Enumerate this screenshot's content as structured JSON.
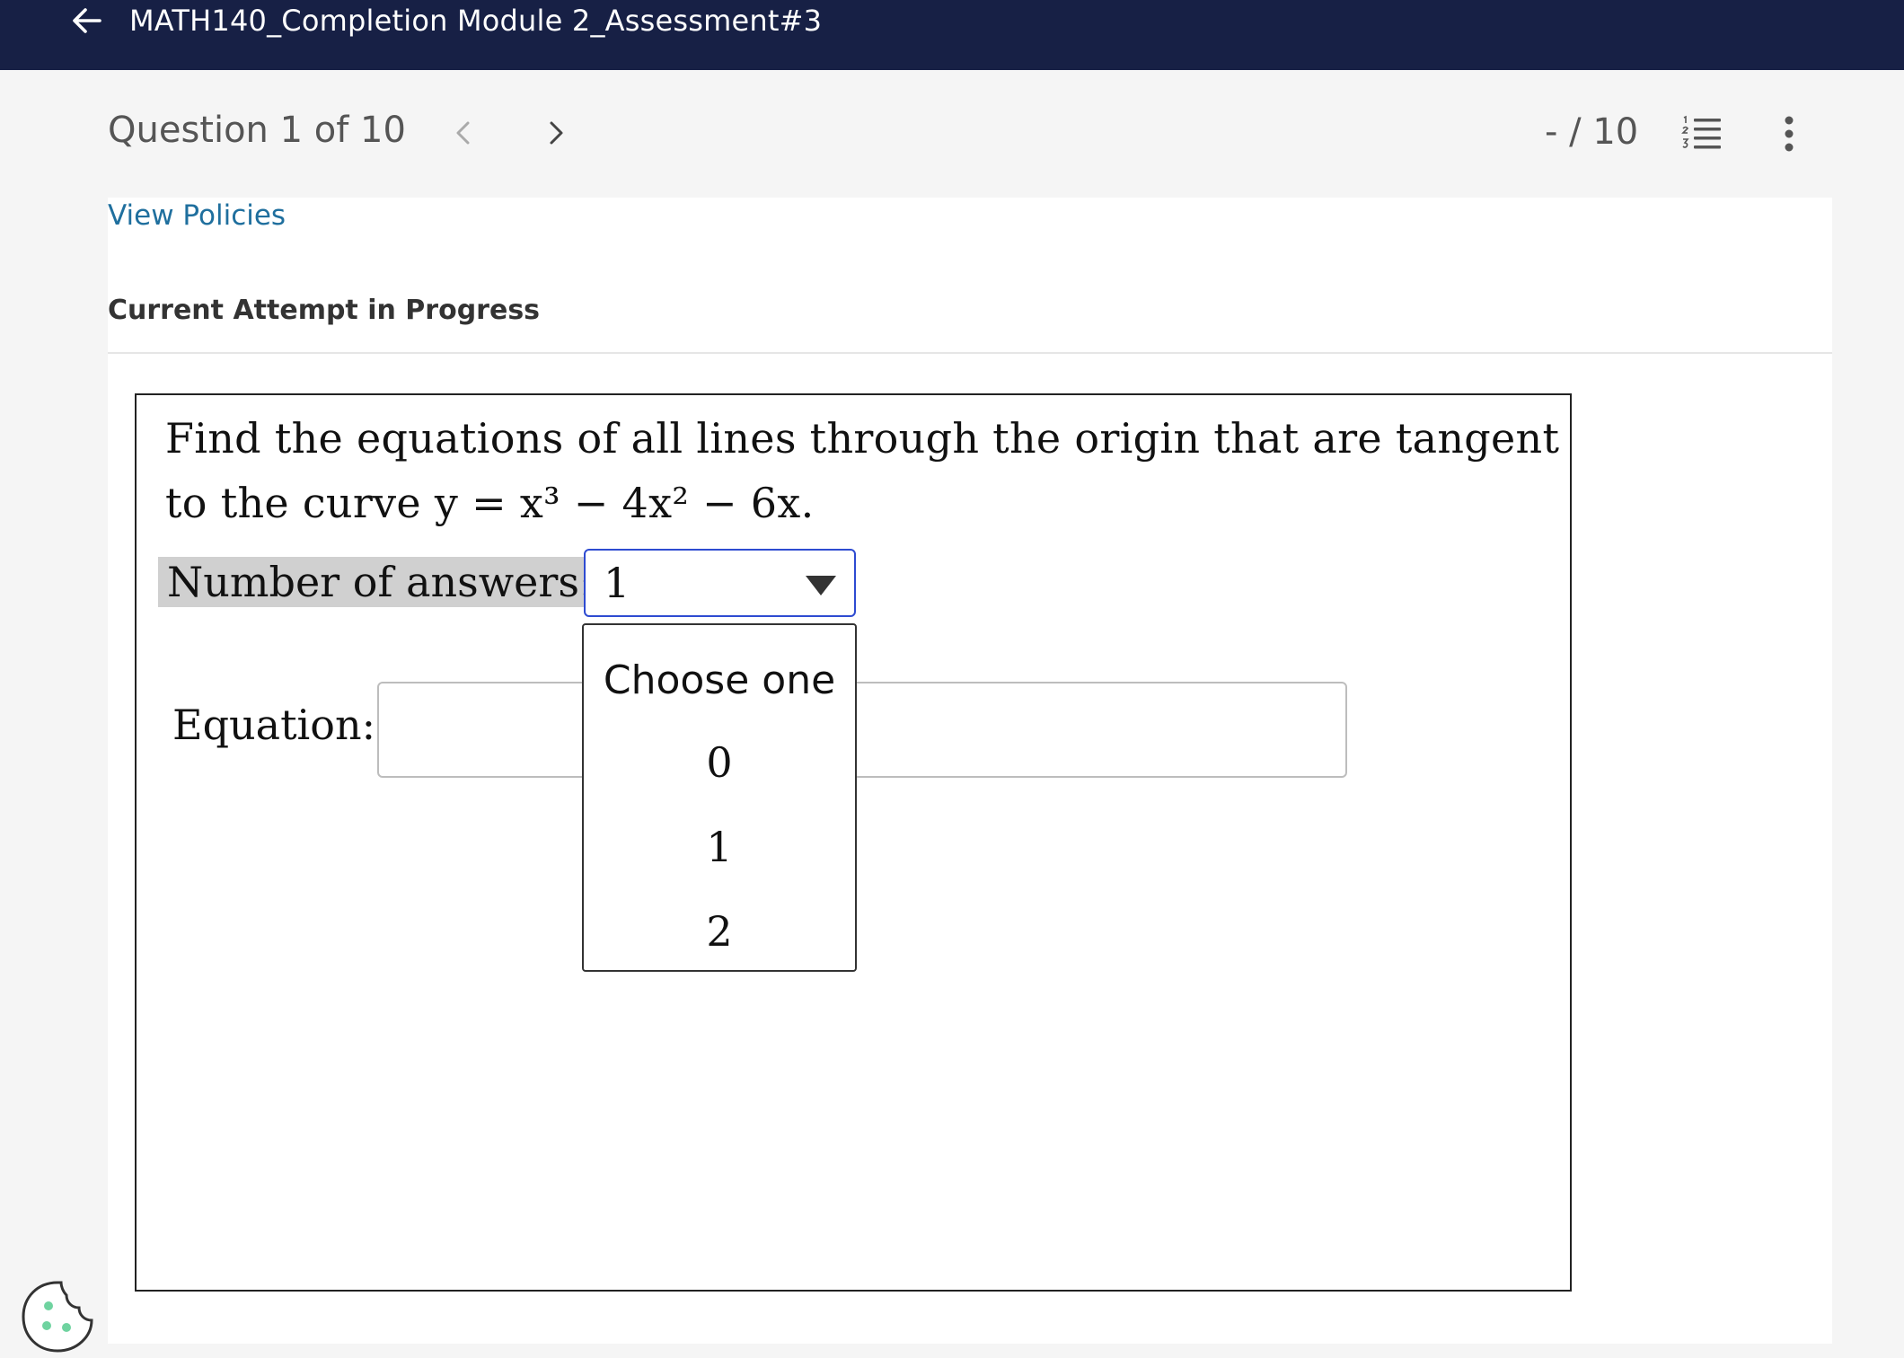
{
  "header": {
    "title": "MATH140_Completion Module 2_Assessment#3",
    "back_icon": "arrow-left-icon"
  },
  "question_nav": {
    "label": "Question 1 of 10",
    "score": "- / 10",
    "prev_icon": "chevron-left-icon",
    "next_icon": "chevron-right-icon",
    "list_icon": "numbered-list-icon",
    "more_icon": "more-vertical-icon"
  },
  "links": {
    "view_policies": "View Policies"
  },
  "attempt": {
    "status": "Current Attempt in Progress"
  },
  "question": {
    "line1": "Find the equations of all lines through the origin that are tangent",
    "line2_prefix": "to the curve ",
    "equation": "y = x³ − 4x² − 6x."
  },
  "answers_select": {
    "label": "Number of answers:",
    "selected": "1",
    "options": [
      "Choose one",
      "0",
      "1",
      "2"
    ]
  },
  "equation_field": {
    "label": "Equation:",
    "value": ""
  },
  "colors": {
    "header_bg": "#172045",
    "link": "#1f6f9e",
    "select_border": "#2e4bd1",
    "cookie_accent": "#6fd3a0"
  }
}
